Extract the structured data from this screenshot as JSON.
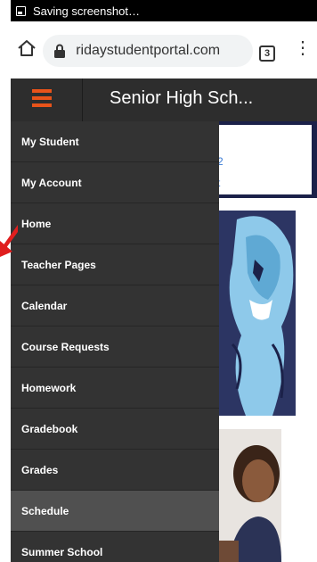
{
  "status_bar": {
    "text": "Saving screenshot…"
  },
  "browser": {
    "url": " ridaystudentportal.com",
    "tab_count": "3"
  },
  "site": {
    "title": "Senior High Sch..."
  },
  "news_box": {
    "line1": "2",
    "line2": "t"
  },
  "drawer": {
    "items": [
      {
        "label": "My Student"
      },
      {
        "label": "My Account"
      },
      {
        "label": "Home"
      },
      {
        "label": "Teacher Pages"
      },
      {
        "label": "Calendar"
      },
      {
        "label": "Course Requests"
      },
      {
        "label": "Homework"
      },
      {
        "label": "Gradebook"
      },
      {
        "label": "Grades"
      },
      {
        "label": "Schedule"
      },
      {
        "label": "Summer School"
      }
    ],
    "active_item": "Schedule"
  },
  "colors": {
    "accent": "#e8531a",
    "header_bg": "#2d2d2d",
    "drawer_bg": "#333333",
    "annotation_arrow": "#e01e1e"
  }
}
